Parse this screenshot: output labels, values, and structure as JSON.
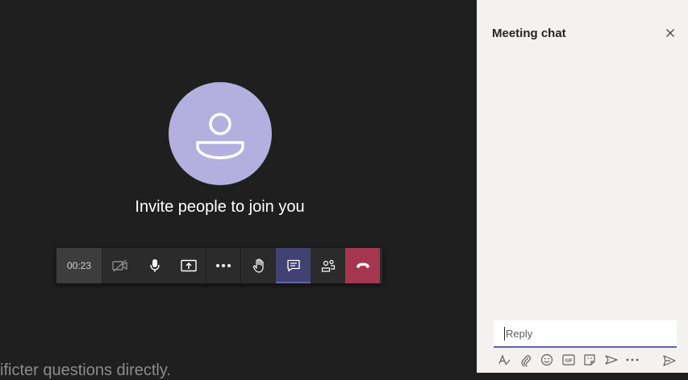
{
  "stage": {
    "invite_text": "Invite people to join you",
    "avatar_color": "#b3b0e0",
    "bottom_text": "ificter questions directly."
  },
  "toolbar": {
    "timer": "00:23",
    "buttons": [
      {
        "name": "camera-off-button",
        "icon": "camera-off-icon"
      },
      {
        "name": "microphone-button",
        "icon": "microphone-icon"
      },
      {
        "name": "share-screen-button",
        "icon": "share-screen-icon"
      },
      {
        "name": "more-actions-button",
        "icon": "more-icon"
      },
      {
        "name": "raise-hand-button",
        "icon": "hand-icon"
      },
      {
        "name": "chat-button",
        "icon": "chat-icon"
      },
      {
        "name": "participants-button",
        "icon": "participants-icon"
      },
      {
        "name": "hang-up-button",
        "icon": "phone-hangup-icon"
      }
    ],
    "hangup_color": "#a4374f",
    "active_color": "#424272"
  },
  "panel": {
    "title": "Meeting chat",
    "reply_placeholder": "Reply",
    "compose_tools": [
      "format-icon",
      "attach-icon",
      "emoji-icon",
      "gif-icon",
      "sticker-icon",
      "meet-now-icon",
      "more-icon"
    ],
    "accent": "#6264a7"
  }
}
